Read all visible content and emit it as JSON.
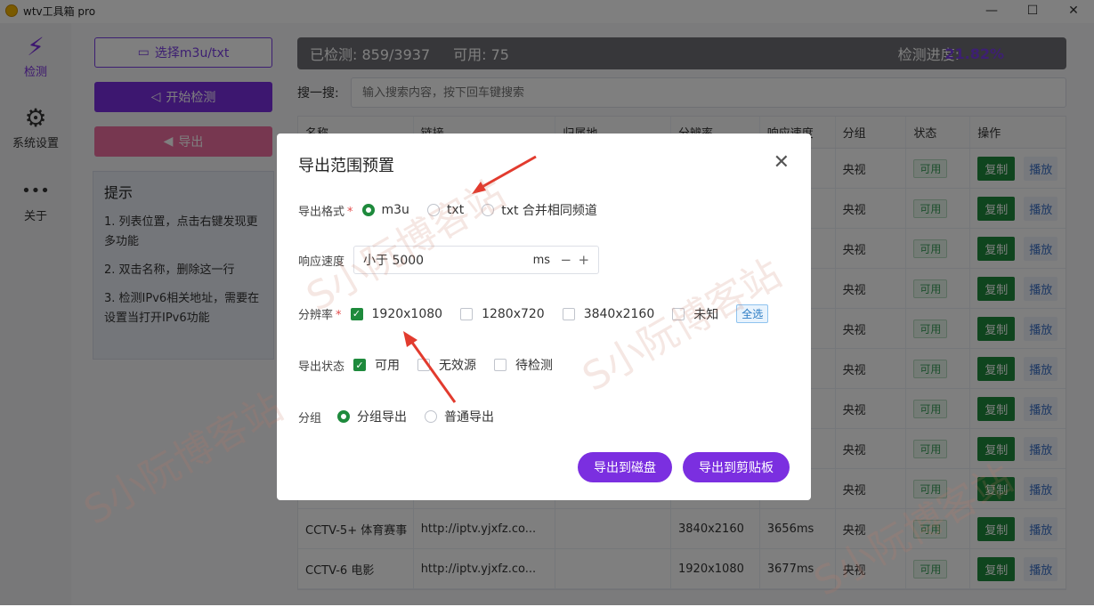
{
  "window": {
    "title": "wtv工具箱 pro",
    "minimize": "—",
    "maximize": "☐",
    "close": "✕"
  },
  "sidebar": {
    "items": [
      {
        "icon": "lightning-icon",
        "glyph": "⚡",
        "label": "检测"
      },
      {
        "icon": "gear-icon",
        "glyph": "⚙",
        "label": "系统设置"
      },
      {
        "icon": "more-icon",
        "glyph": "•••",
        "label": "关于"
      }
    ]
  },
  "left_panel": {
    "select_button": "选择m3u/txt",
    "start_button": "开始检测",
    "export_button": "导出",
    "tips_title": "提示",
    "tips": [
      "1. 列表位置，点击右键发现更多功能",
      "2. 双击名称，删除这一行",
      "3. 检测IPv6相关地址，需要在设置当打开IPv6功能"
    ]
  },
  "status": {
    "checked": "已检测: 859/3937",
    "available": "可用: 75",
    "progress_label": "检测进度:",
    "progress": "21.82%"
  },
  "search": {
    "label": "搜一搜:",
    "placeholder": "输入搜索内容，按下回车键搜索"
  },
  "table": {
    "columns": [
      "名称",
      "链接",
      "归属地",
      "分辨率",
      "响应速度",
      "分组",
      "状态",
      "操作"
    ],
    "rows": [
      {
        "name": "",
        "link": "",
        "loc": "",
        "res": "",
        "speed": "",
        "group": "央视",
        "state": "可用"
      },
      {
        "name": "",
        "link": "",
        "loc": "",
        "res": "",
        "speed": "s",
        "group": "央视",
        "state": "可用"
      },
      {
        "name": "",
        "link": "",
        "loc": "",
        "res": "",
        "speed": "s",
        "group": "央视",
        "state": "可用"
      },
      {
        "name": "",
        "link": "",
        "loc": "",
        "res": "",
        "speed": "s",
        "group": "央视",
        "state": "可用"
      },
      {
        "name": "",
        "link": "",
        "loc": "",
        "res": "",
        "speed": "s",
        "group": "央视",
        "state": "可用"
      },
      {
        "name": "",
        "link": "",
        "loc": "",
        "res": "",
        "speed": "s",
        "group": "央视",
        "state": "可用"
      },
      {
        "name": "",
        "link": "",
        "loc": "",
        "res": "",
        "speed": "s",
        "group": "央视",
        "state": "可用"
      },
      {
        "name": "",
        "link": "",
        "loc": "",
        "res": "",
        "speed": "s",
        "group": "央视",
        "state": "可用"
      },
      {
        "name": "",
        "link": "",
        "loc": "",
        "res": "",
        "speed": "s",
        "group": "央视",
        "state": "可用"
      },
      {
        "name": "CCTV-5+ 体育赛事",
        "link": "http://iptv.yjxfz.co...",
        "loc": "",
        "res": "3840x2160",
        "speed": "3656ms",
        "group": "央视",
        "state": "可用"
      },
      {
        "name": "CCTV-6 电影",
        "link": "http://iptv.yjxfz.co...",
        "loc": "",
        "res": "1920x1080",
        "speed": "3677ms",
        "group": "央视",
        "state": "可用"
      }
    ],
    "copy_label": "复制",
    "play_label": "播放"
  },
  "modal": {
    "title": "导出范围预置",
    "close": "✕",
    "format_label": "导出格式",
    "format_options": [
      "m3u",
      "txt",
      "txt 合并相同频道"
    ],
    "format_selected": "m3u",
    "speed_label": "响应速度",
    "speed_value": "小于 5000",
    "speed_unit": "ms",
    "speed_minus": "−",
    "speed_plus": "+",
    "res_label": "分辨率",
    "res_options": [
      "1920x1080",
      "1280x720",
      "3840x2160",
      "未知"
    ],
    "res_checked": [
      "1920x1080"
    ],
    "select_all": "全选",
    "state_label": "导出状态",
    "state_options": [
      "可用",
      "无效源",
      "待检测"
    ],
    "state_checked": [
      "可用"
    ],
    "group_label": "分组",
    "group_options": [
      "分组导出",
      "普通导出"
    ],
    "group_selected": "分组导出",
    "export_disk": "导出到磁盘",
    "export_clipboard": "导出到剪贴板"
  },
  "watermark": "S小阮博客站",
  "colors": {
    "accent": "#7b2fe0",
    "green": "#1e8a3c",
    "pink": "#ee6fa0",
    "progress": "#7b3fe4"
  }
}
